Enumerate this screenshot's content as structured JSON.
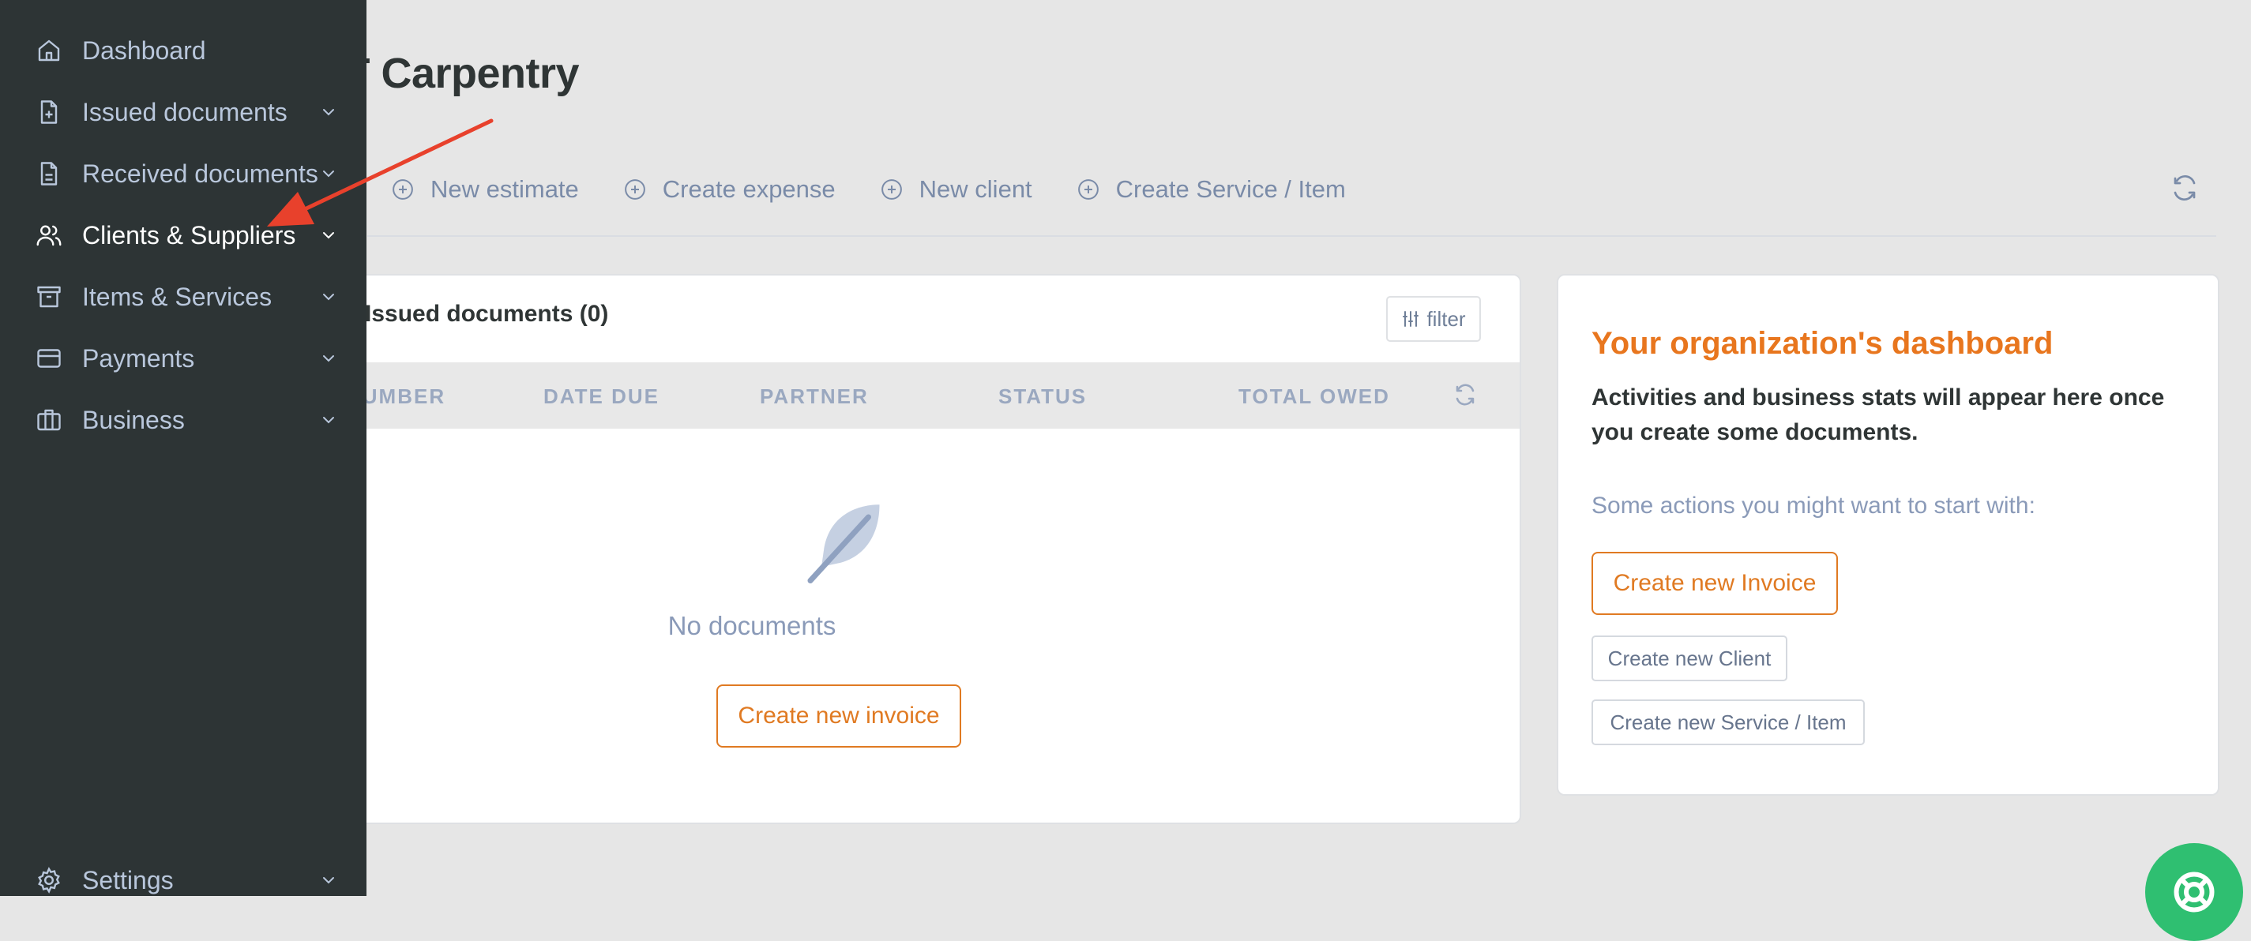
{
  "page": {
    "title": "WT Carpentry"
  },
  "toolbar": {
    "buttons": [
      {
        "label": "New estimate"
      },
      {
        "label": "Create expense"
      },
      {
        "label": "New client"
      },
      {
        "label": "Create Service / Item"
      }
    ]
  },
  "documents": {
    "title": "Issued documents (0)",
    "filter_label": "filter",
    "columns": [
      "NUMBER",
      "DATE DUE",
      "PARTNER",
      "STATUS",
      "TOTAL OWED"
    ],
    "empty_text": "No documents",
    "create_invoice_label": "Create new invoice"
  },
  "org_dashboard": {
    "title": "Your organization's dashboard",
    "description": "Activities and business stats will appear here once you create some documents.",
    "hint": "Some actions you might want to start with:",
    "actions": [
      "Create new Invoice",
      "Create new Client",
      "Create new Service / Item"
    ]
  },
  "sidebar": {
    "items": [
      {
        "label": "Dashboard",
        "icon": "home-icon",
        "expandable": false
      },
      {
        "label": "Issued documents",
        "icon": "document-plus-icon",
        "expandable": true
      },
      {
        "label": "Received documents",
        "icon": "document-icon",
        "expandable": true
      },
      {
        "label": "Clients & Suppliers",
        "icon": "users-icon",
        "expandable": true,
        "active": true
      },
      {
        "label": "Items & Services",
        "icon": "archive-box-icon",
        "expandable": true
      },
      {
        "label": "Payments",
        "icon": "credit-card-icon",
        "expandable": true
      },
      {
        "label": "Business",
        "icon": "briefcase-icon",
        "expandable": true
      }
    ],
    "settings": {
      "label": "Settings",
      "icon": "gear-icon",
      "expandable": true
    }
  },
  "colors": {
    "sidebar_bg": "#2d3435",
    "accent_orange": "#e8761e",
    "annotation_arrow": "#e8412c",
    "help_button": "#2fbf71"
  }
}
